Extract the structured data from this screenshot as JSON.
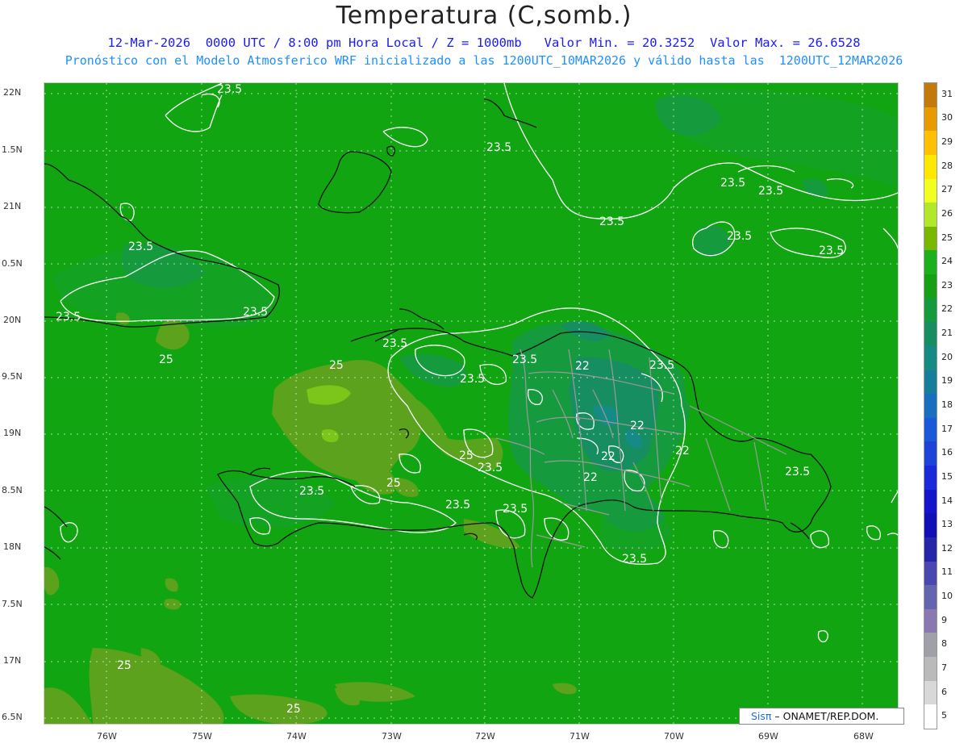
{
  "header": {
    "title": "Temperatura (C,somb.)",
    "line1": "12-Mar-2026  0000 UTC / 8:00 pm Hora Local / Z = 1000mb   Valor Min. = 20.3252  Valor Max. = 26.6528",
    "line2": "Pronóstico con el Modelo Atmosferico WRF inicializado a las 1200UTC_10MAR2026 y válido hasta las  1200UTC_12MAR2026"
  },
  "axes": {
    "lat_labels": [
      "22N",
      "1.5N",
      "21N",
      "0.5N",
      "20N",
      "9.5N",
      "19N",
      "8.5N",
      "18N",
      "7.5N",
      "17N",
      "6.5N"
    ],
    "lon_labels": [
      "76W",
      "75W",
      "74W",
      "73W",
      "72W",
      "71W",
      "70W",
      "69W",
      "68W"
    ]
  },
  "contour_labels": [
    "23.5",
    "23.5",
    "23.5",
    "23.5",
    "23.5",
    "23.5",
    "23.5",
    "23.5",
    "23.5",
    "23.5",
    "23.5",
    "23.5",
    "23.5",
    "23.5",
    "23.5",
    "23.5",
    "23.5",
    "25",
    "25",
    "25",
    "25",
    "25",
    "25",
    "22",
    "22",
    "22",
    "22",
    "22"
  ],
  "colorbar": {
    "labels": [
      "31",
      "30",
      "29",
      "28",
      "27",
      "26",
      "25",
      "24",
      "23",
      "22",
      "21",
      "20",
      "19",
      "18",
      "17",
      "16",
      "15",
      "14",
      "13",
      "12",
      "11",
      "10",
      "9",
      "8",
      "7",
      "6",
      "5"
    ],
    "colors": [
      "#c47a0a",
      "#e89a00",
      "#ffc000",
      "#ffe800",
      "#f0ff20",
      "#b2e82a",
      "#7ab800",
      "#1cb01c",
      "#16a016",
      "#159a3e",
      "#178d62",
      "#168a84",
      "#167d9a",
      "#1a6ec0",
      "#1a5ad8",
      "#1c44d8",
      "#1a2ad8",
      "#1414c8",
      "#1010b4",
      "#2626a8",
      "#4848b0",
      "#6464b0",
      "#8a78b0",
      "#a0a0a8",
      "#bababa",
      "#d8d8d8",
      "#ffffff"
    ]
  },
  "credit": {
    "brand": "Sisπ",
    "org": " – ONAMET/REP.DOM."
  },
  "style": {
    "ocean_color": "#12a512",
    "contour_color": "#ffffff",
    "coast_color": "#111111",
    "province_color": "#9a9a9a"
  }
}
